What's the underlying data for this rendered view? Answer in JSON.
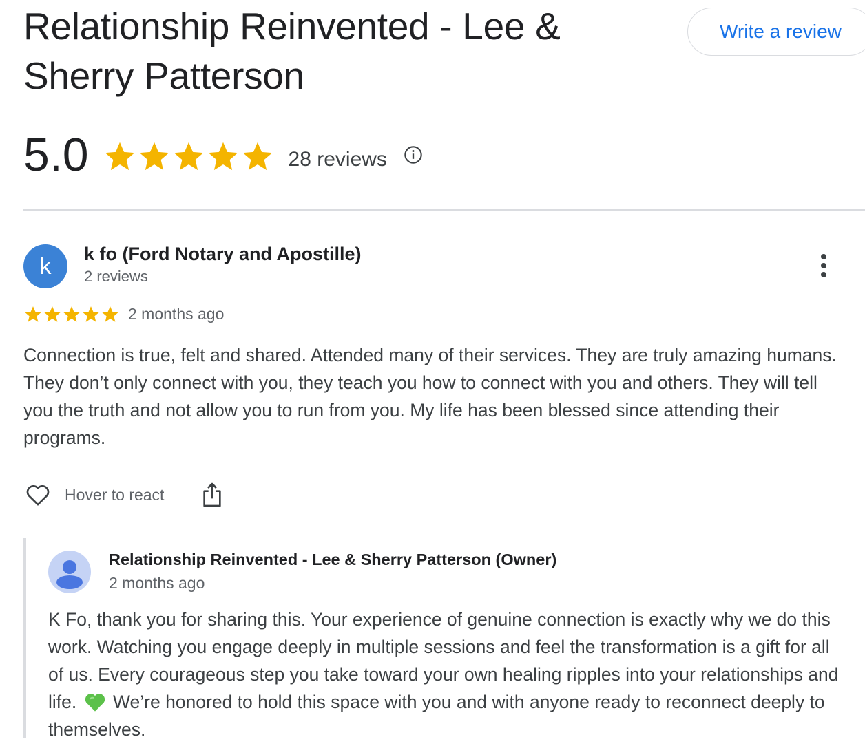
{
  "business": {
    "title": "Relationship Reinvented - Lee & Sherry Patterson",
    "write_review_label": "Write a review",
    "rating_value": "5.0",
    "rating_stars": 5,
    "review_count_label": "28 reviews",
    "star_color": "#f4b400"
  },
  "review": {
    "avatar_letter": "k",
    "avatar_color": "#3b82d6",
    "reviewer_name": "k fo (Ford Notary and Apostille)",
    "reviewer_meta": "2 reviews",
    "stars": 5,
    "date": "2 months ago",
    "text": "Connection is true, felt and shared. Attended many of their services. They are truly amazing humans. They don’t only connect with you, they teach you how to connect with you and others. They will tell you the truth and not allow you to run from you. My life has been blessed since attending their programs.",
    "react_label": "Hover to react"
  },
  "owner_reply": {
    "name": "Relationship Reinvented - Lee & Sherry Patterson (Owner)",
    "date": "2 months ago",
    "text_before_emoji": "K Fo, thank you for sharing this. Your experience of genuine connection is exactly why we do this work. Watching you engage deeply in multiple sessions and feel the transformation is a gift for all of us. Every courageous step you take toward your own healing ripples into your relationships and life.",
    "text_after_emoji": "We’re honored to hold this space with you and with anyone ready to reconnect deeply to themselves.",
    "emoji": "green-heart-icon"
  },
  "icons": [
    "star-icon",
    "info-icon",
    "more-vert-icon",
    "heart-outline-icon",
    "share-icon",
    "person-avatar-icon",
    "green-heart-icon"
  ]
}
